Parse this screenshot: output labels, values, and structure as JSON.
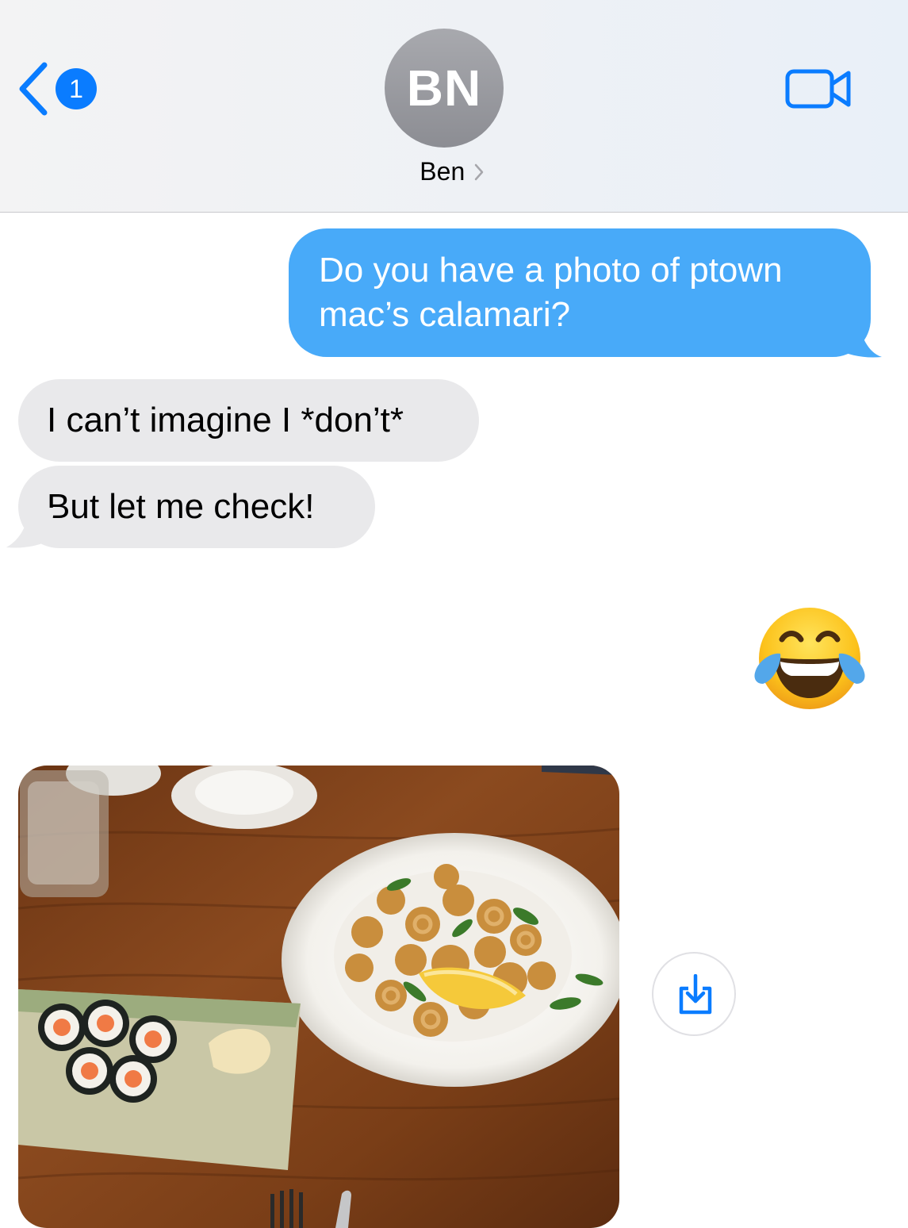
{
  "header": {
    "back_badge_count": "1",
    "back_icon": "chevron-left-icon",
    "avatar_initials": "BN",
    "contact_name": "Ben",
    "contact_chevron_icon": "chevron-right-icon",
    "video_icon": "facetime-video-icon"
  },
  "messages": [
    {
      "direction": "sent",
      "text": "Do you have a photo of ptown mac’s calamari?"
    },
    {
      "direction": "received",
      "text": "I can’t imagine I *don’t*"
    },
    {
      "direction": "received",
      "text": "But let me check!"
    },
    {
      "direction": "sent",
      "type": "emoji",
      "emoji": "face-with-tears-of-joy"
    },
    {
      "direction": "received",
      "type": "photo",
      "description_icon": "photo-attachment"
    }
  ],
  "share_button": {
    "icon": "save-download-icon"
  },
  "colors": {
    "sent_bubble": "#48aaf9",
    "received_bubble": "#e9e9eb",
    "accent": "#0a7cff",
    "avatar": "#98999e"
  }
}
